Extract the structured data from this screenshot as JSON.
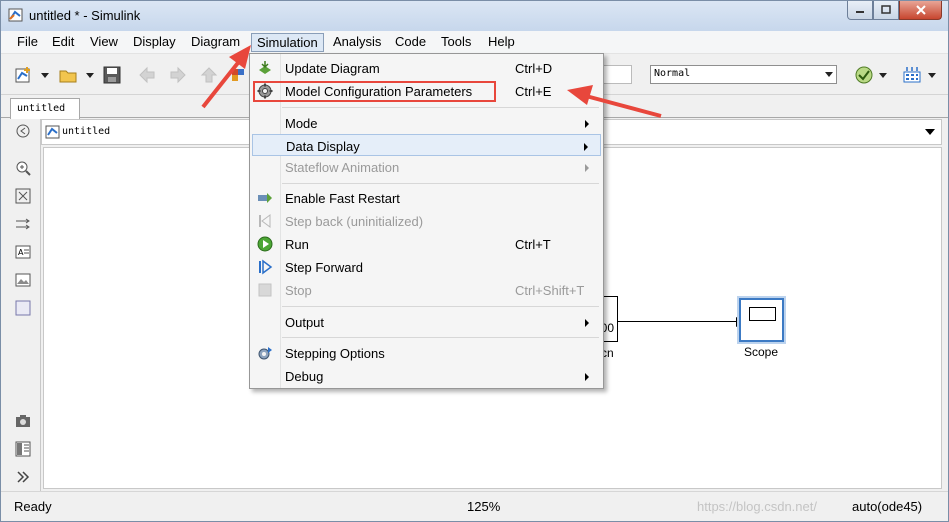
{
  "window": {
    "title": "untitled * - Simulink"
  },
  "menubar": {
    "items": [
      "File",
      "Edit",
      "View",
      "Display",
      "Diagram",
      "Simulation",
      "Analysis",
      "Code",
      "Tools",
      "Help"
    ],
    "active": "Simulation"
  },
  "toolbar": {
    "sim_mode": "Normal"
  },
  "tabs": [
    "untitled"
  ],
  "address": {
    "path": "untitled"
  },
  "canvas": {
    "clock_value": "00",
    "clock_label_partial": "cn",
    "scope_label": "Scope"
  },
  "simulation_menu": {
    "update_diagram": {
      "label": "Update Diagram",
      "shortcut": "Ctrl+D"
    },
    "model_config": {
      "label": "Model Configuration Parameters",
      "shortcut": "Ctrl+E"
    },
    "mode": {
      "label": "Mode"
    },
    "data_display": {
      "label": "Data Display"
    },
    "stateflow_animation": {
      "label": "Stateflow Animation"
    },
    "enable_fast_restart": {
      "label": "Enable Fast Restart"
    },
    "step_back": {
      "label": "Step back (uninitialized)"
    },
    "run": {
      "label": "Run",
      "shortcut": "Ctrl+T"
    },
    "step_forward": {
      "label": "Step Forward"
    },
    "stop": {
      "label": "Stop",
      "shortcut": "Ctrl+Shift+T"
    },
    "output": {
      "label": "Output"
    },
    "stepping_options": {
      "label": "Stepping Options"
    },
    "debug": {
      "label": "Debug"
    }
  },
  "statusbar": {
    "ready": "Ready",
    "zoom": "125%",
    "solver": "auto(ode45)",
    "watermark": "https://blog.csdn.net/"
  },
  "colors": {
    "annotation_red": "#e8473c",
    "menu_hover": "#e5eef9",
    "selection_blue": "#3c7ac4"
  }
}
